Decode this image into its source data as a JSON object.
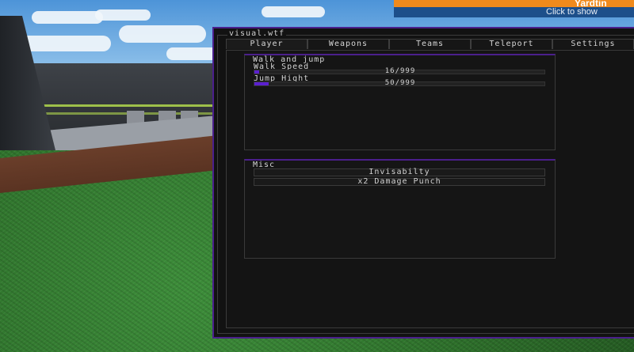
{
  "notification": {
    "title": "Yardtin",
    "subtitle": "Click to show"
  },
  "window": {
    "title": "visual.wtf",
    "accent_color": "#4b1f8c",
    "tabs": [
      {
        "label": "Player",
        "active": true
      },
      {
        "label": "Weapons",
        "active": false
      },
      {
        "label": "Teams",
        "active": false
      },
      {
        "label": "Teleport",
        "active": false
      },
      {
        "label": "Settings",
        "active": false
      }
    ]
  },
  "walk_section": {
    "title": "Walk and jump",
    "walk_speed": {
      "label": "Walk Speed",
      "value_text": "16/999",
      "value": 16,
      "max": 999
    },
    "jump_height": {
      "label": "Jump Hight",
      "value_text": "50/999",
      "value": 50,
      "max": 999
    }
  },
  "misc_section": {
    "title": "Misc",
    "buttons": [
      "Invisabilty",
      "x2 Damage Punch"
    ]
  }
}
